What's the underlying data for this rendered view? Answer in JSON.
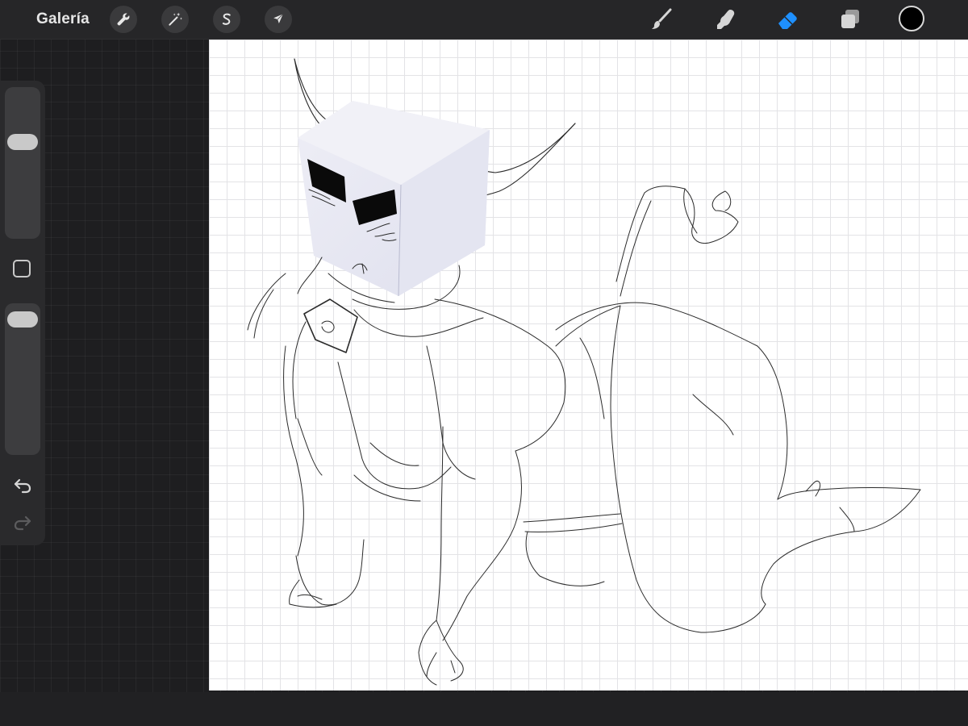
{
  "toolbar": {
    "gallery_label": "Galería",
    "left_tools": [
      {
        "name": "actions",
        "icon": "wrench-icon"
      },
      {
        "name": "adjustments",
        "icon": "magic-wand-icon"
      },
      {
        "name": "selection",
        "icon": "selection-s-icon"
      },
      {
        "name": "transform",
        "icon": "arrow-cursor-icon"
      }
    ],
    "right_tools": [
      {
        "name": "brush",
        "icon": "brush-icon"
      },
      {
        "name": "smudge",
        "icon": "smudge-finger-icon"
      },
      {
        "name": "eraser",
        "icon": "eraser-icon",
        "active": true
      },
      {
        "name": "layers",
        "icon": "layers-icon"
      }
    ],
    "current_color": "#000000",
    "active_color": "#1e90ff"
  },
  "sidebar": {
    "brush_size_level": 0.34,
    "opacity_level": 0.04,
    "modify_icon": "square-icon",
    "undo_icon": "undo-arrow-icon",
    "redo_icon": "redo-arrow-icon"
  }
}
